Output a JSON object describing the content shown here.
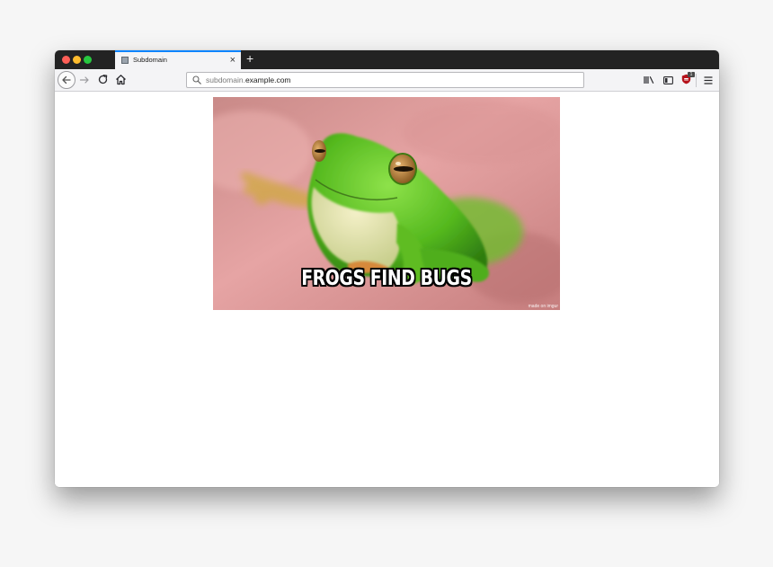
{
  "browser": {
    "tab": {
      "title": "Subdomain",
      "close_glyph": "×"
    },
    "new_tab_glyph": "+",
    "urlbar": {
      "prefix": "subdomain.",
      "host": "example.com"
    },
    "toolbar_icons": [
      "back-icon",
      "forward-icon",
      "reload-icon",
      "home-icon",
      "search-icon",
      "library-icon",
      "sidebar-icon",
      "extension-icon",
      "menu-icon"
    ],
    "extension_badge": "1"
  },
  "page": {
    "image": {
      "caption": "FROGS FIND BUGS",
      "watermark": "made on imgur",
      "subject": "green tree frog on pink background"
    }
  },
  "colors": {
    "tabstrip": "#232323",
    "active_tab_accent": "#0a84ff",
    "traffic_close": "#fe5f57",
    "traffic_minimize": "#febc2e",
    "traffic_maximize": "#28c840"
  }
}
